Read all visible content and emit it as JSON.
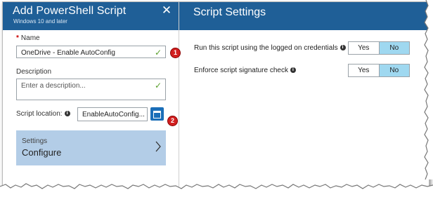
{
  "left_panel": {
    "title": "Add PowerShell Script",
    "subtitle": "Windows 10 and later",
    "close_glyph": "✕",
    "name": {
      "required_mark": "*",
      "label": "Name",
      "value": "OneDrive - Enable AutoConfig"
    },
    "description": {
      "label": "Description",
      "placeholder": "Enter a description..."
    },
    "script_location": {
      "label": "Script location:",
      "value": "EnableAutoConfig..."
    },
    "settings_tile": {
      "title": "Settings",
      "subtitle": "Configure"
    },
    "callouts": [
      "1",
      "2"
    ]
  },
  "right_panel": {
    "title": "Script Settings",
    "settings": [
      {
        "label": "Run this script using the logged on credentials",
        "options": [
          "Yes",
          "No"
        ],
        "selected": "No"
      },
      {
        "label": "Enforce script signature check",
        "options": [
          "Yes",
          "No"
        ],
        "selected": "No"
      }
    ]
  },
  "icons": {
    "info": "info-icon",
    "check": "check-icon",
    "browse": "folder-icon",
    "chevron": "chevron-right-icon"
  },
  "colors": {
    "header_bg": "#1f5f97",
    "tile_bg": "#b3cde7",
    "selected_toggle": "#9fd8f0",
    "callout": "#d21f1f",
    "check": "#5aa02c"
  }
}
